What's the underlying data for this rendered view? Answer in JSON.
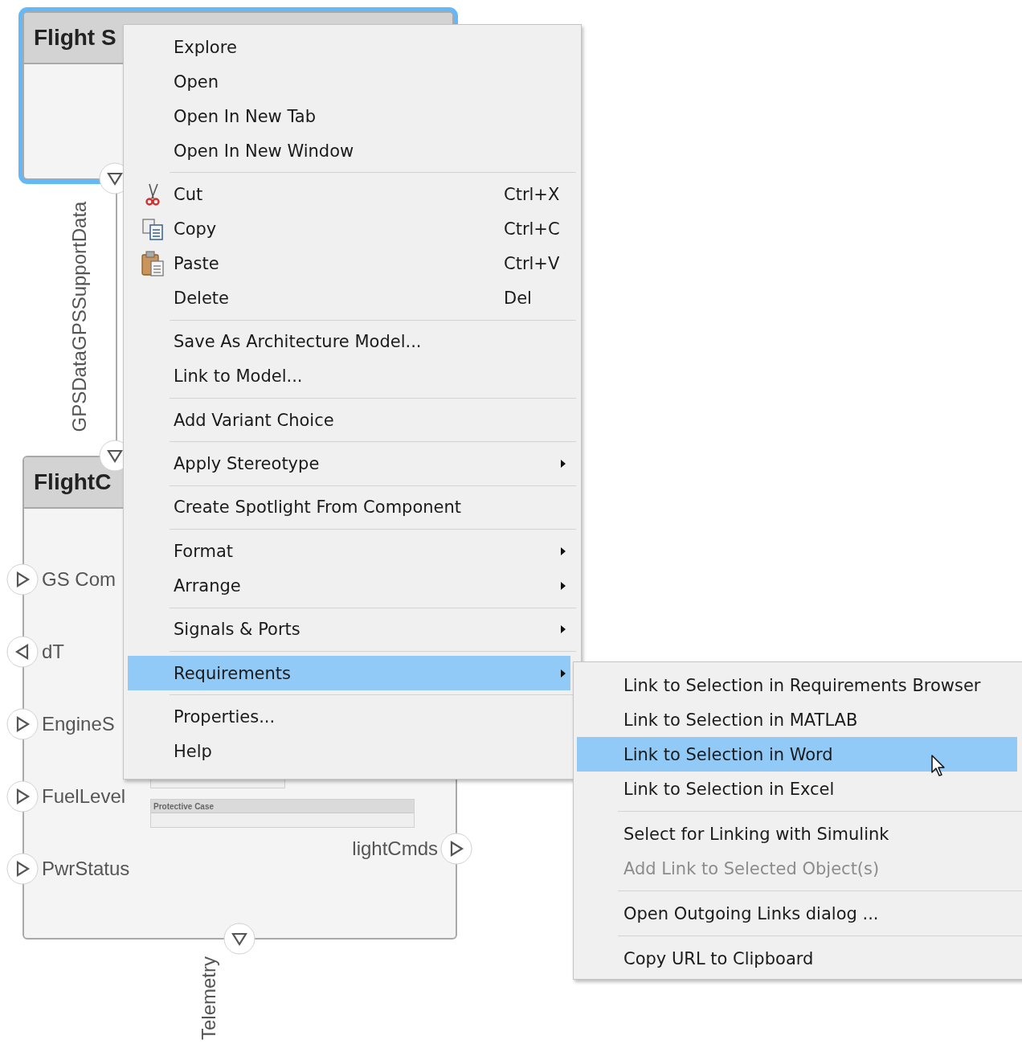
{
  "diagram": {
    "components": [
      {
        "title": "Flight S",
        "selected": true
      },
      {
        "title": "FlightC",
        "selected": false,
        "inports": [
          {
            "label": "GS Com",
            "kind": "in"
          },
          {
            "label": "dT",
            "kind": "out"
          },
          {
            "label": "EngineS",
            "kind": "in"
          },
          {
            "label": "FuelLevel",
            "kind": "in"
          },
          {
            "label": "PwrStatus",
            "kind": "in"
          }
        ],
        "outports": [
          {
            "label": "lightCmds",
            "kind": "out"
          }
        ],
        "inner_blocks": [
          {
            "title": "Protective Case"
          }
        ],
        "bottom_port": {
          "label": "Telemetry",
          "kind": "out"
        }
      }
    ],
    "connections": [
      {
        "label": "GPSDataGPSSupportData"
      }
    ]
  },
  "context_menu": {
    "groups": [
      {
        "items": [
          {
            "label": "Explore",
            "selected": false,
            "submenu": false
          },
          {
            "label": "Open",
            "selected": false,
            "submenu": false
          },
          {
            "label": "Open In New Tab",
            "selected": false,
            "submenu": false
          },
          {
            "label": "Open In New Window",
            "selected": false,
            "submenu": false
          }
        ]
      },
      {
        "items": [
          {
            "label": "Cut",
            "shortcut": "Ctrl+X",
            "kind": "scissors",
            "selected": false,
            "submenu": false
          },
          {
            "label": "Copy",
            "shortcut": "Ctrl+C",
            "kind": "copy",
            "selected": false,
            "submenu": false
          },
          {
            "label": "Paste",
            "shortcut": "Ctrl+V",
            "kind": "paste",
            "selected": false,
            "submenu": false
          },
          {
            "label": "Delete",
            "shortcut": "Del",
            "selected": false,
            "submenu": false
          }
        ]
      },
      {
        "items": [
          {
            "label": "Save As Architecture Model...",
            "selected": false,
            "submenu": false
          },
          {
            "label": "Link to Model...",
            "selected": false,
            "submenu": false
          }
        ]
      },
      {
        "items": [
          {
            "label": "Add Variant Choice",
            "selected": false,
            "submenu": false
          }
        ]
      },
      {
        "items": [
          {
            "label": "Apply Stereotype",
            "selected": false,
            "submenu": true
          }
        ]
      },
      {
        "items": [
          {
            "label": "Create Spotlight From Component",
            "selected": false,
            "submenu": false
          }
        ]
      },
      {
        "items": [
          {
            "label": "Format",
            "selected": false,
            "submenu": true
          },
          {
            "label": "Arrange",
            "selected": false,
            "submenu": true
          }
        ]
      },
      {
        "items": [
          {
            "label": "Signals & Ports",
            "selected": false,
            "submenu": true
          }
        ]
      },
      {
        "items": [
          {
            "label": "Requirements",
            "selected": true,
            "submenu": true
          }
        ]
      },
      {
        "items": [
          {
            "label": "Properties...",
            "selected": false,
            "submenu": false
          },
          {
            "label": "Help",
            "selected": false,
            "submenu": false
          }
        ]
      }
    ]
  },
  "submenu": {
    "groups": [
      {
        "items": [
          {
            "label": "Link to Selection in Requirements Browser",
            "selected": false,
            "disabled": false
          },
          {
            "label": "Link to Selection in MATLAB",
            "selected": false,
            "disabled": false
          },
          {
            "label": "Link to Selection in Word",
            "selected": true,
            "disabled": false
          },
          {
            "label": "Link to Selection in Excel",
            "selected": false,
            "disabled": false
          }
        ]
      },
      {
        "items": [
          {
            "label": "Select for Linking with Simulink",
            "selected": false,
            "disabled": false
          },
          {
            "label": "Add Link to Selected Object(s)",
            "selected": false,
            "disabled": true
          }
        ]
      },
      {
        "items": [
          {
            "label": "Open Outgoing Links dialog ...",
            "selected": false,
            "disabled": false
          }
        ]
      },
      {
        "items": [
          {
            "label": "Copy URL to Clipboard",
            "selected": false,
            "disabled": false
          }
        ]
      }
    ]
  }
}
